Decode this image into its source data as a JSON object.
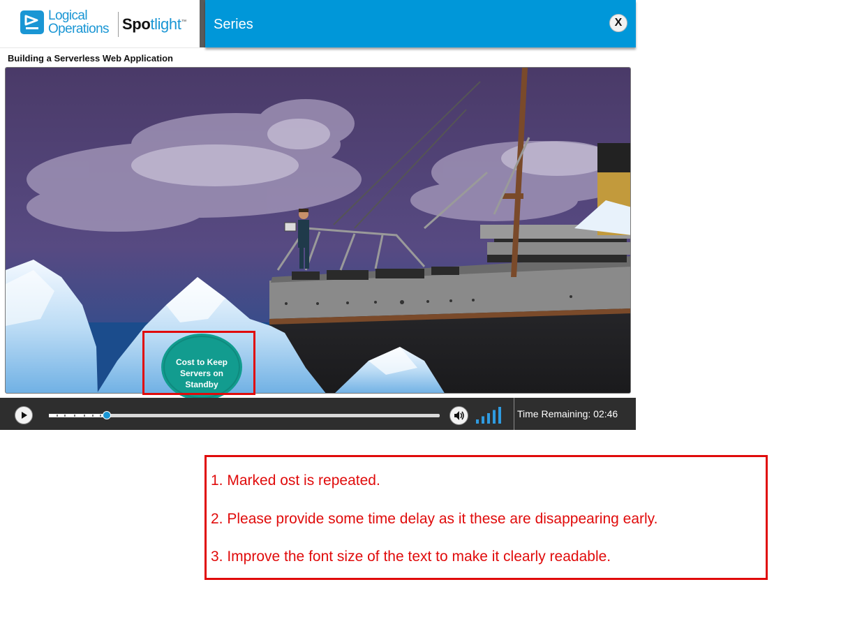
{
  "brand": {
    "logo_line1": "Logical",
    "logo_line2": "Operations",
    "product_prefix": "Sp",
    "product_o": "o",
    "product_t": "t",
    "product_suffix": "light",
    "trademark": "™",
    "accent_color": "#1a96d4"
  },
  "header": {
    "title": "Series",
    "close_label": "X",
    "bar_color": "#0097d9"
  },
  "course": {
    "title": "Building a Serverless Web Application"
  },
  "video": {
    "overlay_text": "Cost to Keep Servers on Standby",
    "overlay_color": "#129c8f"
  },
  "player": {
    "progress": 0.148,
    "chapter_markers": [
      0.02,
      0.04,
      0.065,
      0.09,
      0.11,
      0.13
    ],
    "volume_level_bars": 5,
    "time_remaining": "Time Remaining: 02:46",
    "play_icon": "play-icon",
    "volume_icon": "speaker-icon"
  },
  "review_notes": [
    "1. Marked ost is repeated.",
    "2. Please provide some time delay as it these are disappearing early.",
    "3. Improve the font size of the text to make it clearly readable."
  ],
  "annotation_color": "#e00b0b"
}
